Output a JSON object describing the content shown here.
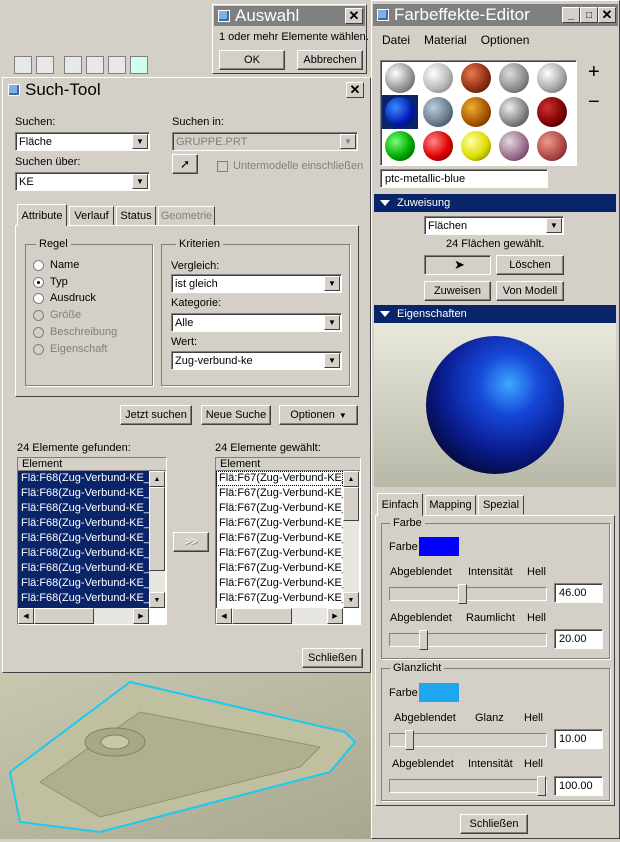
{
  "auswahl": {
    "title": "Auswahl",
    "message": "1 oder mehr Elemente wählen.",
    "ok": "OK",
    "cancel": "Abbrechen"
  },
  "tool": {
    "title": "Such-Tool",
    "search_label": "Suchen:",
    "search_value": "Fläche",
    "search_in_label": "Suchen in:",
    "search_in_value": "GRUPPE.PRT",
    "search_over_label": "Suchen über:",
    "search_over_value": "KE",
    "submodels": "Untermodelle einschließen",
    "tabs": [
      "Attribute",
      "Verlauf",
      "Status",
      "Geometrie"
    ],
    "rule_label": "Regel",
    "rules": [
      "Name",
      "Typ",
      "Ausdruck",
      "Größe",
      "Beschreibung",
      "Eigenschaft"
    ],
    "criteria_label": "Kriterien",
    "compare_label": "Vergleich:",
    "compare_value": "ist gleich",
    "category_label": "Kategorie:",
    "category_value": "Alle",
    "value_label": "Wert:",
    "value_value": "Zug-verbund-ke",
    "search_now": "Jetzt suchen",
    "new_search": "Neue Suche",
    "options": "Optionen",
    "found_label": "24 Elemente gefunden:",
    "selected_label": "24 Elemente gewählt:",
    "col_header": "Element",
    "found_rows": [
      "Flä:F68(Zug-Verbund-KE_",
      "Flä:F68(Zug-Verbund-KE_",
      "Flä:F68(Zug-Verbund-KE_",
      "Flä:F68(Zug-Verbund-KE_",
      "Flä:F68(Zug-Verbund-KE_",
      "Flä:F68(Zug-Verbund-KE_",
      "Flä:F68(Zug-Verbund-KE_",
      "Flä:F68(Zug-Verbund-KE_",
      "Flä:F68(Zug-Verbund-KE_",
      "Flä:F68(Zug-Verbund-KE_"
    ],
    "selected_rows": [
      "Flä:F67(Zug-Verbund-KE_",
      "Flä:F67(Zug-Verbund-KE_",
      "Flä:F67(Zug-Verbund-KE_",
      "Flä:F67(Zug-Verbund-KE_",
      "Flä:F67(Zug-Verbund-KE_",
      "Flä:F67(Zug-Verbund-KE_",
      "Flä:F67(Zug-Verbund-KE_",
      "Flä:F67(Zug-Verbund-KE_",
      "Flä:F67(Zug-Verbund-KE_",
      "Flä:F67(Zug-Verbund-KE_"
    ],
    "transfer": ">>",
    "close": "Schließen"
  },
  "editor": {
    "title": "Farbeffekte-Editor",
    "menu": [
      "Datei",
      "Material",
      "Optionen"
    ],
    "plus": "+",
    "minus": "−",
    "material_name": "ptc-metallic-blue",
    "assign_header": "Zuweisung",
    "assign_type": "Flächen",
    "assign_count": "24 Flächen gewählt.",
    "delete": "Löschen",
    "assign": "Zuweisen",
    "from_model": "Von Modell",
    "props_header": "Eigenschaften",
    "tabs": [
      "Einfach",
      "Mapping",
      "Spezial"
    ],
    "color_group": "Farbe",
    "color_label": "Farbe",
    "color_value": "#0000ff",
    "dim": "Abgeblendet",
    "intensity": "Intensität",
    "bright": "Hell",
    "ambient": "Raumlicht",
    "intensity_value": "46.00",
    "ambient_value": "20.00",
    "intensity_level": 0.46,
    "ambient_level": 0.2,
    "highlight_group": "Glanzlicht",
    "hl_color_label": "Farbe",
    "hl_color_value": "#1ea7f0",
    "gloss": "Glanz",
    "gloss_value": "10.00",
    "hl_intensity_value": "100.00",
    "gloss_level": 0.1,
    "hl_intensity_level": 1.0,
    "close": "Schließen"
  }
}
